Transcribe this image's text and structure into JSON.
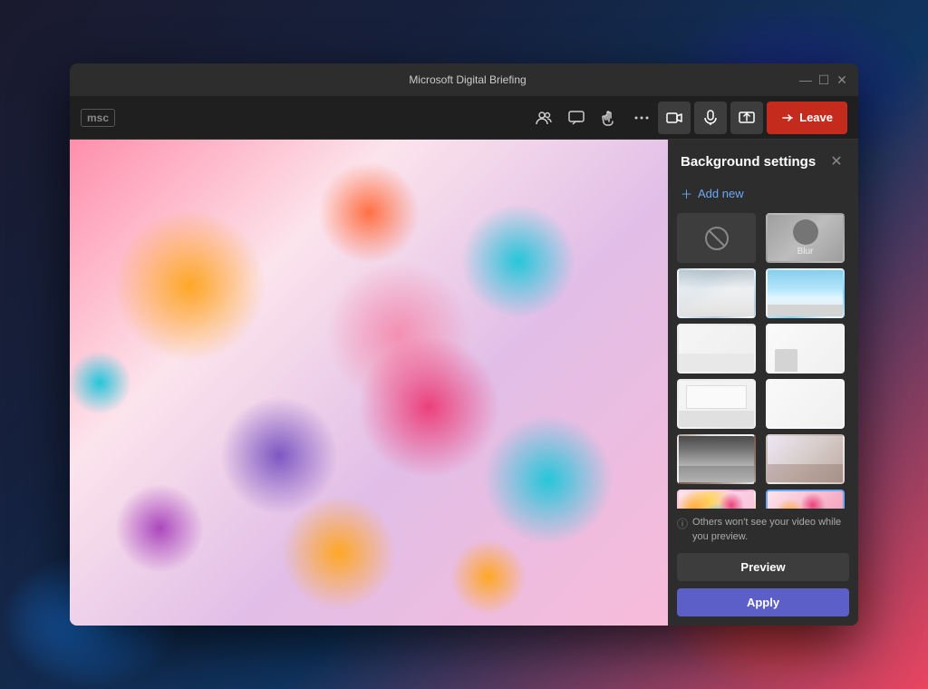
{
  "window": {
    "title": "Microsoft Digital Briefing",
    "controls": {
      "minimize": "—",
      "maximize": "☐",
      "close": "✕"
    }
  },
  "toolbar": {
    "logo": "msc",
    "icons": [
      "people",
      "chat",
      "hand",
      "more"
    ],
    "leave_label": "Leave"
  },
  "video": {
    "description": "Colorful 3D balls background"
  },
  "background_settings": {
    "title": "Background settings",
    "add_new_label": "+ Add new",
    "thumbnails": [
      {
        "id": "none",
        "label": "None",
        "type": "none"
      },
      {
        "id": "blur",
        "label": "Blur",
        "type": "blur"
      },
      {
        "id": "office1",
        "label": "Office interior",
        "type": "bg1"
      },
      {
        "id": "outdoor1",
        "label": "City skyline",
        "type": "bg2"
      },
      {
        "id": "room1",
        "label": "White room",
        "type": "bg3"
      },
      {
        "id": "room2",
        "label": "Bedroom",
        "type": "bg4"
      },
      {
        "id": "room3",
        "label": "Minimal room",
        "type": "bg5"
      },
      {
        "id": "room4",
        "label": "White wall",
        "type": "bg6"
      },
      {
        "id": "office2",
        "label": "Industrial office",
        "type": "bg7"
      },
      {
        "id": "wall1",
        "label": "Plain wall",
        "type": "bg8"
      },
      {
        "id": "balls1",
        "label": "Colorful balls 1",
        "type": "bg9",
        "selected": false
      },
      {
        "id": "balls2",
        "label": "Colorful balls 2",
        "type": "bg10",
        "selected": true
      }
    ],
    "info_text": "Others won't see your video while you preview.",
    "preview_label": "Preview",
    "apply_label": "Apply"
  }
}
